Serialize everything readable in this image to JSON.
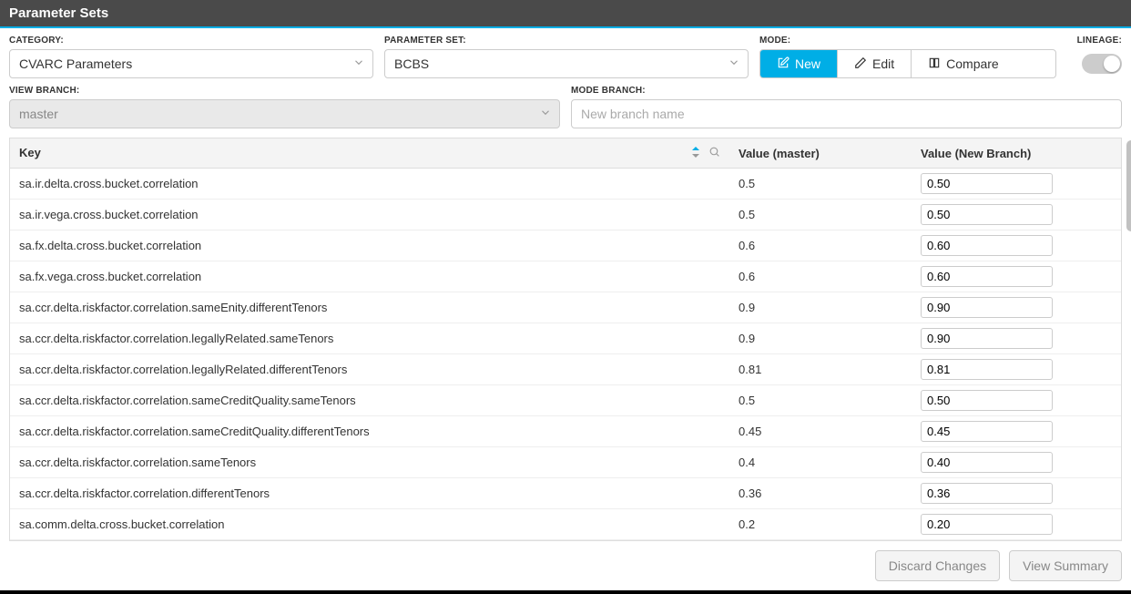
{
  "header": {
    "title": "Parameter Sets"
  },
  "labels": {
    "category": "CATEGORY:",
    "parameter_set": "PARAMETER SET:",
    "mode": "MODE:",
    "lineage": "LINEAGE:",
    "view_branch": "VIEW BRANCH:",
    "mode_branch": "MODE BRANCH:"
  },
  "category": {
    "value": "CVARC Parameters"
  },
  "parameter_set": {
    "value": "BCBS"
  },
  "mode": {
    "new": "New",
    "edit": "Edit",
    "compare": "Compare"
  },
  "view_branch": {
    "value": "master"
  },
  "mode_branch": {
    "placeholder": "New branch name"
  },
  "columns": {
    "key": "Key",
    "value_master": "Value (master)",
    "value_new": "Value (New Branch)"
  },
  "rows": [
    {
      "key": "sa.ir.delta.cross.bucket.correlation",
      "master": "0.5",
      "new": "0.50"
    },
    {
      "key": "sa.ir.vega.cross.bucket.correlation",
      "master": "0.5",
      "new": "0.50"
    },
    {
      "key": "sa.fx.delta.cross.bucket.correlation",
      "master": "0.6",
      "new": "0.60"
    },
    {
      "key": "sa.fx.vega.cross.bucket.correlation",
      "master": "0.6",
      "new": "0.60"
    },
    {
      "key": "sa.ccr.delta.riskfactor.correlation.sameEnity.differentTenors",
      "master": "0.9",
      "new": "0.90"
    },
    {
      "key": "sa.ccr.delta.riskfactor.correlation.legallyRelated.sameTenors",
      "master": "0.9",
      "new": "0.90"
    },
    {
      "key": "sa.ccr.delta.riskfactor.correlation.legallyRelated.differentTenors",
      "master": "0.81",
      "new": "0.81"
    },
    {
      "key": "sa.ccr.delta.riskfactor.correlation.sameCreditQuality.sameTenors",
      "master": "0.5",
      "new": "0.50"
    },
    {
      "key": "sa.ccr.delta.riskfactor.correlation.sameCreditQuality.differentTenors",
      "master": "0.45",
      "new": "0.45"
    },
    {
      "key": "sa.ccr.delta.riskfactor.correlation.sameTenors",
      "master": "0.4",
      "new": "0.40"
    },
    {
      "key": "sa.ccr.delta.riskfactor.correlation.differentTenors",
      "master": "0.36",
      "new": "0.36"
    },
    {
      "key": "sa.comm.delta.cross.bucket.correlation",
      "master": "0.2",
      "new": "0.20"
    }
  ],
  "footer": {
    "discard": "Discard Changes",
    "summary": "View Summary"
  }
}
